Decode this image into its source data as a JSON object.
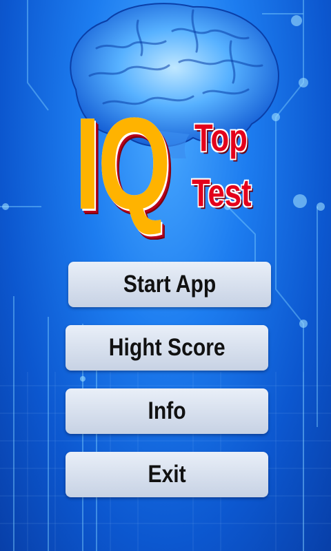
{
  "logo": {
    "iq": "IQ",
    "top": "Top",
    "test": "Test"
  },
  "menu": {
    "items": [
      {
        "label": "Start App"
      },
      {
        "label": "Hight Score"
      },
      {
        "label": "Info"
      },
      {
        "label": "Exit"
      }
    ]
  },
  "colors": {
    "background": "#1d7df0",
    "button": "#dbe3f0",
    "logo_iq": "#ffb300",
    "logo_words": "#e4001b"
  },
  "icons": [
    "brain-image",
    "circuit-background"
  ]
}
